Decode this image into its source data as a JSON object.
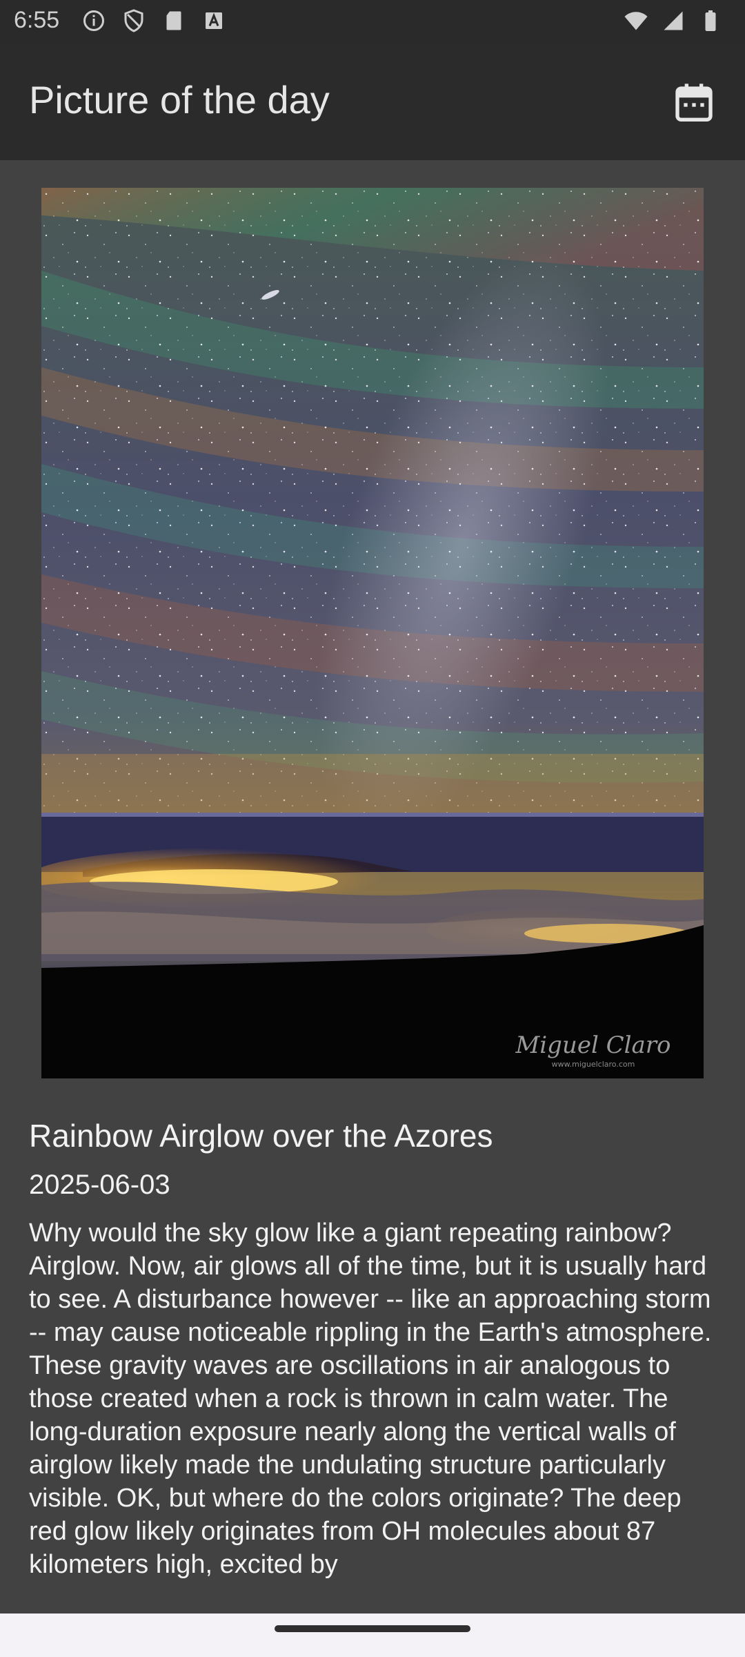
{
  "status_bar": {
    "time": "6:55",
    "left_icons": [
      "info-icon",
      "shield-icon",
      "sd-card-icon",
      "a-icon"
    ],
    "right_icons": [
      "wifi-icon",
      "signal-icon",
      "battery-icon"
    ]
  },
  "app_bar": {
    "title": "Picture of the day",
    "calendar_icon": "calendar-icon"
  },
  "photo": {
    "watermark": "Miguel Claro",
    "watermark_url": "www.miguelclaro.com",
    "title": "Rainbow Airglow over the Azores",
    "date": "2025-06-03",
    "description": "Why would the sky glow like a giant repeating rainbow?  Airglow.  Now, air glows all of the time, but it is usually hard to see. A disturbance however -- like an approaching storm -- may cause noticeable rippling in the Earth's atmosphere. These gravity waves are oscillations in air analogous to those created when a rock is thrown in calm water.  The long-duration exposure nearly along the vertical walls of airglow likely made the undulating structure particularly visible.  OK, but where do the colors originate?  The deep red glow likely originates from OH molecules about 87 kilometers high, excited by"
  },
  "colors": {
    "background": "#424242",
    "app_bar": "#2b2b2b",
    "status_bar": "#2a2a2a",
    "nav_bar": "#f4f2f7",
    "text": "#f2f2f2"
  }
}
